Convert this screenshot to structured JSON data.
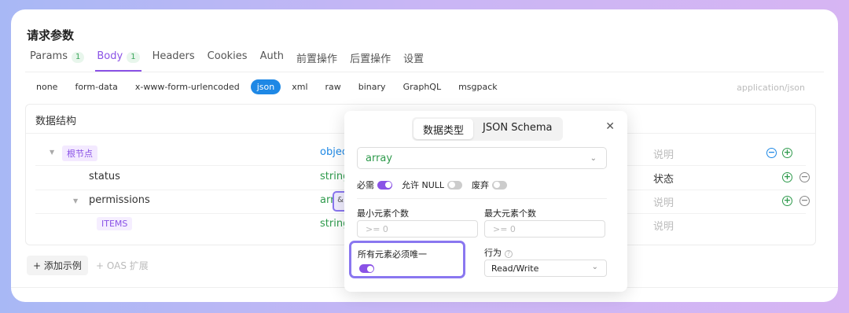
{
  "title": "请求参数",
  "tabs": [
    {
      "label": "Params",
      "count": "1"
    },
    {
      "label": "Body",
      "count": "1"
    },
    {
      "label": "Headers"
    },
    {
      "label": "Cookies"
    },
    {
      "label": "Auth"
    },
    {
      "label": "前置操作"
    },
    {
      "label": "后置操作"
    },
    {
      "label": "设置"
    }
  ],
  "body_types": [
    "none",
    "form-data",
    "x-www-form-urlencoded",
    "json",
    "xml",
    "raw",
    "binary",
    "GraphQL",
    "msgpack"
  ],
  "active_body_type": "json",
  "content_type": "application/json",
  "schema": {
    "header": "数据结构",
    "rows": [
      {
        "name": "根节点",
        "type": "object",
        "desc": "说明"
      },
      {
        "name": "status",
        "type": "string",
        "desc": "状态"
      },
      {
        "name": "permissions",
        "type": "array",
        "desc": "说明"
      },
      {
        "name": "ITEMS",
        "type": "string",
        "desc": "说明"
      }
    ],
    "mini_glyph": "a",
    "highlight_glyph": "&"
  },
  "actions": {
    "add_example": "+ 添加示例",
    "oas": "+ OAS 扩展"
  },
  "popup": {
    "seg_tabs": [
      "数据类型",
      "JSON Schema"
    ],
    "close": "✕",
    "type_value": "array",
    "options": [
      {
        "label": "必需",
        "on": true
      },
      {
        "label": "允许 NULL",
        "on": false
      },
      {
        "label": "废弃",
        "on": false
      }
    ],
    "min_items_label": "最小元素个数",
    "min_items_placeholder": ">= 0",
    "max_items_label": "最大元素个数",
    "max_items_placeholder": ">= 0",
    "unique_label": "所有元素必须唯一",
    "unique_on": true,
    "behavior_label": "行为",
    "behavior_value": "Read/Write"
  },
  "colors": {
    "accent": "#8a52e6",
    "json_active": "#1e88e5",
    "type_green": "#2e9a4c",
    "type_blue": "#1e88e5",
    "highlight_border": "#8a77f0"
  }
}
